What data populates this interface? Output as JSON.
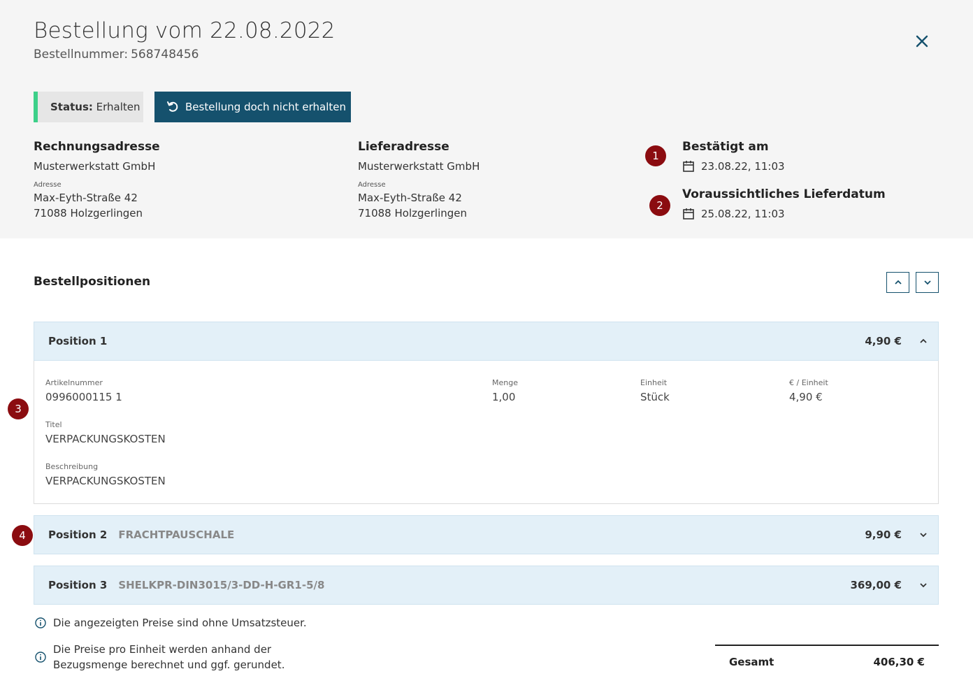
{
  "header": {
    "title": "Bestellung vom 22.08.2022",
    "order_number_label": "Bestellnummer:",
    "order_number": "568748456"
  },
  "status": {
    "label": "Status:",
    "value": "Erhalten",
    "color": "#3dd089"
  },
  "undo_button": {
    "label": "Bestellung doch nicht erhalten",
    "icon": "undo-icon"
  },
  "billing": {
    "heading": "Rechnungsadresse",
    "company": "Musterwerkstatt GmbH",
    "address_label": "Adresse",
    "street": "Max-Eyth-Straße 42",
    "city": "71088 Holzgerlingen"
  },
  "shipping": {
    "heading": "Lieferadresse",
    "company": "Musterwerkstatt GmbH",
    "address_label": "Adresse",
    "street": "Max-Eyth-Straße 42",
    "city": "71088 Holzgerlingen"
  },
  "dates": {
    "confirmed_heading": "Bestätigt am",
    "confirmed_value": "23.08.22, 11:03",
    "delivery_heading": "Voraussichtliches Lieferdatum",
    "delivery_value": "25.08.22, 11:03"
  },
  "markers": [
    "1",
    "2",
    "3",
    "4"
  ],
  "section": {
    "title": "Bestellpositionen"
  },
  "positions": [
    {
      "label": "Position 1",
      "name": "",
      "price": "4,90 €",
      "expanded": true,
      "details": {
        "article_label": "Artikelnummer",
        "article_value": "0996000115 1",
        "qty_label": "Menge",
        "qty_value": "1,00",
        "unit_label": "Einheit",
        "unit_value": "Stück",
        "unit_price_label": "€ / Einheit",
        "unit_price_value": "4,90 €",
        "title_label": "Titel",
        "title_value": "VERPACKUNGSKOSTEN",
        "desc_label": "Beschreibung",
        "desc_value": "VERPACKUNGSKOSTEN"
      }
    },
    {
      "label": "Position 2",
      "name": "FRACHTPAUSCHALE",
      "price": "9,90 €",
      "expanded": false
    },
    {
      "label": "Position 3",
      "name": "SHELKPR-DIN3015/3-DD-H-GR1-5/8",
      "price": "369,00 €",
      "expanded": false
    }
  ],
  "notes": [
    "Die angezeigten Preise sind ohne Umsatzsteuer.",
    "Die Preise pro Einheit werden anhand der",
    "Bezugsmenge berechnet und ggf. gerundet."
  ],
  "total": {
    "label": "Gesamt",
    "value": "406,30 €"
  },
  "colors": {
    "primary": "#15516d",
    "marker": "#8b0c10",
    "accent_bg": "#e3f0f8",
    "status_green": "#3dd089"
  }
}
